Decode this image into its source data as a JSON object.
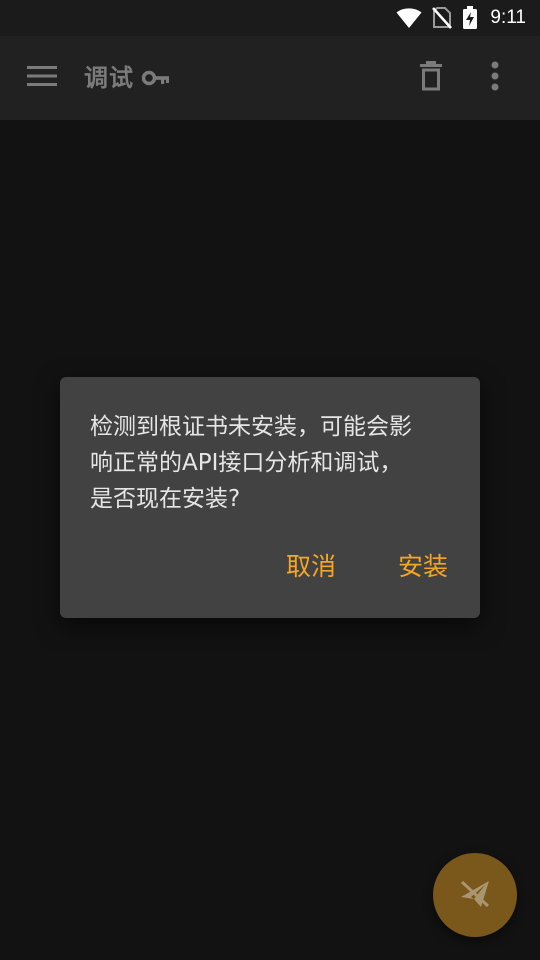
{
  "status_bar": {
    "time": "9:11",
    "icons": [
      "wifi-icon",
      "no-sim-icon",
      "battery-charging-icon"
    ]
  },
  "toolbar": {
    "title": "调试",
    "icons": [
      "menu-icon",
      "key-icon",
      "delete-icon",
      "more-vert-icon"
    ]
  },
  "dialog": {
    "message": "检测到根证书未安装，可能会影\n响正常的API接口分析和调试，\n是否现在安装?",
    "cancel_label": "取消",
    "install_label": "安装"
  },
  "fab": {
    "icon": "send-off-icon"
  },
  "colors": {
    "background": "#121212",
    "toolbar": "#212121",
    "dialog": "#424242",
    "accent": "#f5a623",
    "fab": "#7a571a"
  }
}
